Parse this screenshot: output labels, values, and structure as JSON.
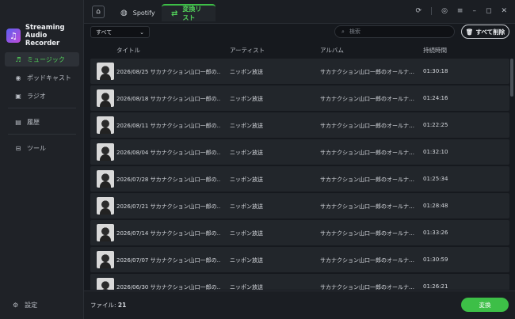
{
  "app": {
    "name_line1": "Streaming",
    "name_line2": "Audio Recorder",
    "logo_glyph": "♫",
    "accent": "#3dbf47"
  },
  "sidebar": {
    "items": [
      {
        "label": "ミュージック",
        "icon": "music-note-icon",
        "glyph": "♬"
      },
      {
        "label": "ポッドキャスト",
        "icon": "podcast-icon",
        "glyph": "◉"
      },
      {
        "label": "ラジオ",
        "icon": "radio-icon",
        "glyph": "▣"
      },
      {
        "label": "履歴",
        "icon": "history-icon",
        "glyph": "▤"
      },
      {
        "label": "ツール",
        "icon": "toolbox-icon",
        "glyph": "⊟"
      }
    ],
    "settings_label": "設定",
    "settings_glyph": "⚙"
  },
  "topbar": {
    "home_glyph": "⌂",
    "tab_spotify": "Spotify",
    "tab_spotify_glyph": "◍",
    "tab_list": "変換リスト",
    "tab_list_glyph": "⇄",
    "controls": {
      "refresh": "⟳",
      "account": "◎",
      "menu": "≡",
      "minimize": "–",
      "maximize": "◻",
      "close": "✕"
    }
  },
  "toolbar": {
    "filter_value": "すべて",
    "filter_chevron": "⌄",
    "search_placeholder": "検索",
    "search_glyph": "⌕",
    "delete_all_label": "すべて削除",
    "delete_glyph": "🗑"
  },
  "table": {
    "columns": [
      "タイトル",
      "アーティスト",
      "アルバム",
      "持続時間"
    ],
    "rows": [
      {
        "title": "2026/08/25 サカナクション山口一郎の…",
        "artist": "ニッポン放送",
        "album": "サカナクション山口一郎のオールナ…",
        "duration": "01:30:18"
      },
      {
        "title": "2026/08/18 サカナクション山口一郎の…",
        "artist": "ニッポン放送",
        "album": "サカナクション山口一郎のオールナ…",
        "duration": "01:24:16"
      },
      {
        "title": "2026/08/11 サカナクション山口一郎の…",
        "artist": "ニッポン放送",
        "album": "サカナクション山口一郎のオールナ…",
        "duration": "01:22:25"
      },
      {
        "title": "2026/08/04 サカナクション山口一郎の…",
        "artist": "ニッポン放送",
        "album": "サカナクション山口一郎のオールナ…",
        "duration": "01:32:10"
      },
      {
        "title": "2026/07/28 サカナクション山口一郎の…",
        "artist": "ニッポン放送",
        "album": "サカナクション山口一郎のオールナ…",
        "duration": "01:25:34"
      },
      {
        "title": "2026/07/21 サカナクション山口一郎の…",
        "artist": "ニッポン放送",
        "album": "サカナクション山口一郎のオールナ…",
        "duration": "01:28:48"
      },
      {
        "title": "2026/07/14 サカナクション山口一郎の…",
        "artist": "ニッポン放送",
        "album": "サカナクション山口一郎のオールナ…",
        "duration": "01:33:26"
      },
      {
        "title": "2026/07/07 サカナクション山口一郎の…",
        "artist": "ニッポン放送",
        "album": "サカナクション山口一郎のオールナ…",
        "duration": "01:30:59"
      },
      {
        "title": "2026/06/30 サカナクション山口一郎の…",
        "artist": "ニッポン放送",
        "album": "サカナクション山口一郎のオールナ…",
        "duration": "01:26:21"
      }
    ]
  },
  "footer": {
    "file_label": "ファイル: ",
    "file_count": "21",
    "convert_label": "変換"
  }
}
